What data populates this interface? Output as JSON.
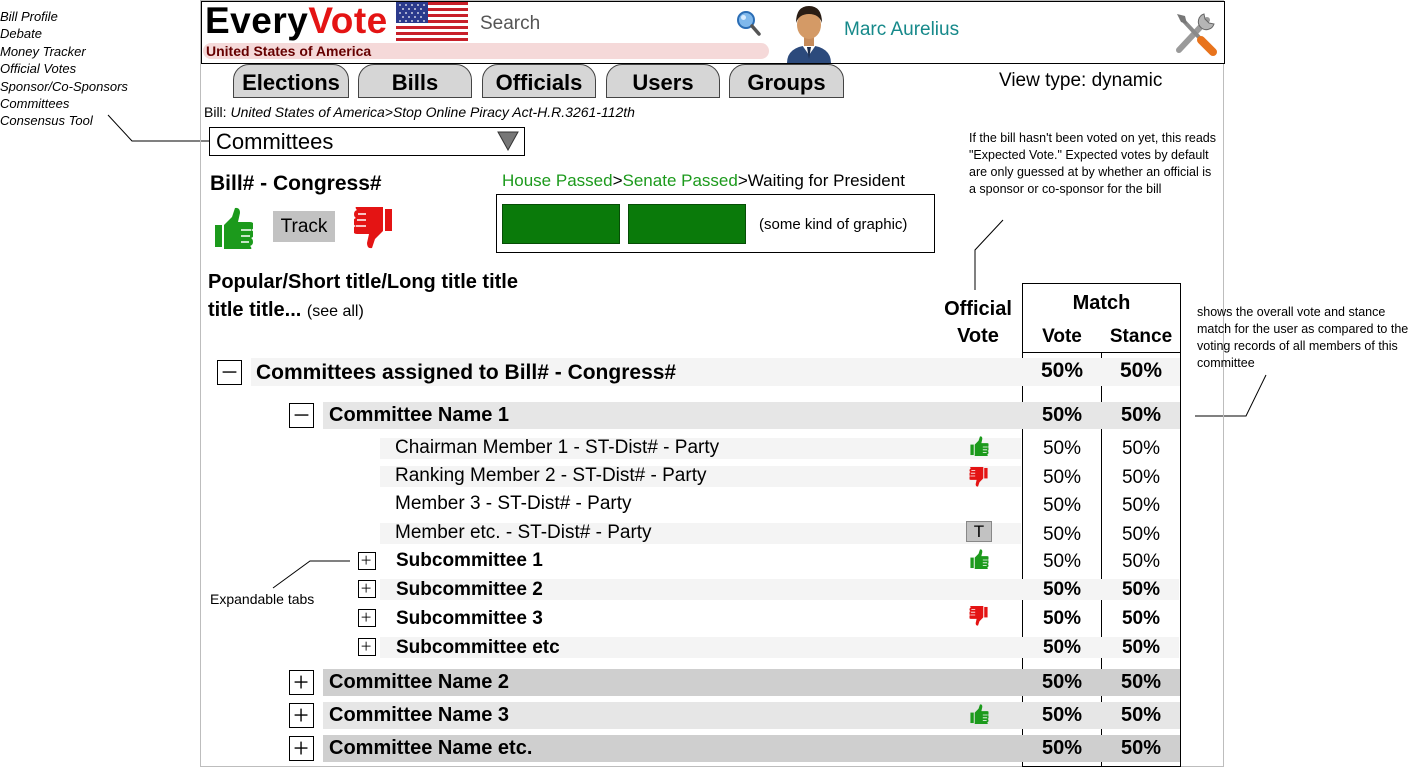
{
  "left_nav": [
    "Bill Profile",
    "Debate",
    "Money Tracker",
    "Official Votes",
    "Sponsor/Co-Sponsors",
    "Committees",
    "Consensus Tool"
  ],
  "header": {
    "logo_every": "Every",
    "logo_vote": "Vote",
    "country": "United States of America",
    "search_placeholder": "Search",
    "username": "Marc Aurelius"
  },
  "tabs": [
    "Elections",
    "Bills",
    "Officials",
    "Users",
    "Groups"
  ],
  "view_type": "View type: dynamic",
  "bill_path_prefix": "Bill: ",
  "bill_path": "United States of America>Stop Online Piracy Act-H.R.3261-112th",
  "dropdown_value": "Committees",
  "bill_number": "Bill# - Congress#",
  "track_label": "Track",
  "status": {
    "house": "House Passed",
    "sep1": ">",
    "senate": "Senate Passed",
    "sep2": ">",
    "president": "Waiting for President"
  },
  "graphic_label": "(some kind of graphic)",
  "title_text": "Popular/Short title/Long title title title title...",
  "see_all": "(see all)",
  "annotations": {
    "expected_vote": "If the bill hasn't been voted on yet, this reads \"Expected Vote.\" Expected votes by default are only guessed at by whether an official is a sponsor or co-sponsor for the bill",
    "match_note": "shows the overall vote and stance match for the user as compared to the voting records of all members of this committee",
    "expandable": "Expandable tabs"
  },
  "columns": {
    "official_line1": "Official",
    "official_line2": "Vote",
    "match": "Match",
    "vote": "Vote",
    "stance": "Stance"
  },
  "rows": {
    "assigned": {
      "label": "Committees assigned to Bill# - Congress#",
      "vote": "50%",
      "stance": "50%"
    },
    "committee1": {
      "label": "Committee Name 1",
      "vote": "50%",
      "stance": "50%"
    },
    "m1": {
      "label": "Chairman Member 1 - ST-Dist# - Party",
      "vote": "50%",
      "stance": "50%",
      "official_vote": "thumbs-up"
    },
    "m2": {
      "label": "Ranking Member 2 - ST-Dist# - Party",
      "vote": "50%",
      "stance": "50%",
      "official_vote": "thumbs-down"
    },
    "m3": {
      "label": "Member 3 - ST-Dist# - Party",
      "vote": "50%",
      "stance": "50%"
    },
    "m4": {
      "label": "Member etc. - ST-Dist# - Party",
      "vote": "50%",
      "stance": "50%",
      "official_vote": "T"
    },
    "s1": {
      "label": "Subcommittee 1",
      "vote": "50%",
      "stance": "50%",
      "official_vote": "thumbs-up"
    },
    "s2": {
      "label": "Subcommittee 2",
      "vote": "50%",
      "stance": "50%"
    },
    "s3": {
      "label": "Subcommittee 3",
      "vote": "50%",
      "stance": "50%",
      "official_vote": "thumbs-down"
    },
    "s4": {
      "label": "Subcommittee etc",
      "vote": "50%",
      "stance": "50%"
    },
    "committee2": {
      "label": "Committee Name 2",
      "vote": "50%",
      "stance": "50%"
    },
    "committee3": {
      "label": "Committee Name 3",
      "vote": "50%",
      "stance": "50%",
      "official_vote": "thumbs-up"
    },
    "committeeEtc": {
      "label": "Committee Name etc.",
      "vote": "50%",
      "stance": "50%"
    }
  },
  "colors": {
    "green": "#1c9a1c",
    "red": "#e41414",
    "accent_teal": "#16898a",
    "bar_green": "#0a7a0a"
  }
}
